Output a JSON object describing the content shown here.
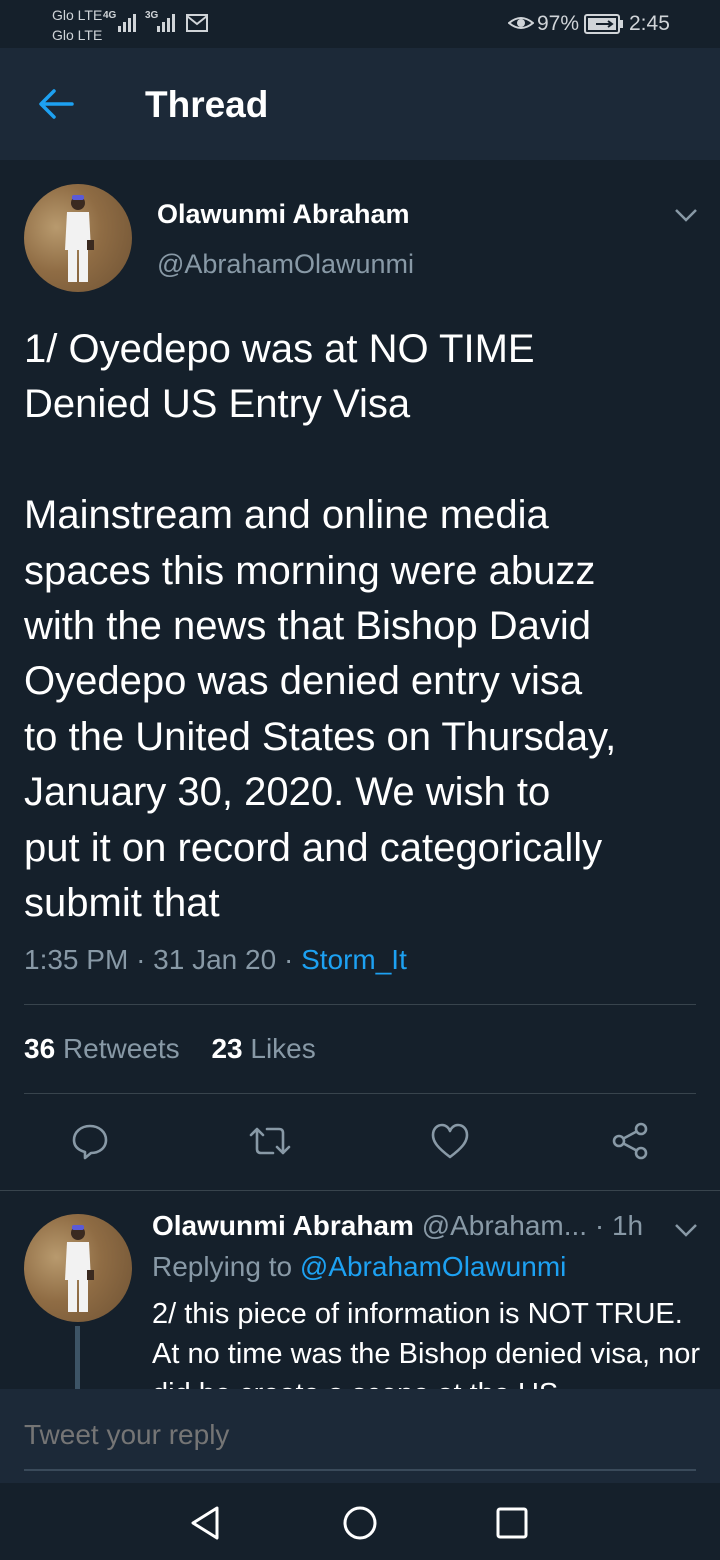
{
  "status_bar": {
    "carrier1": "Glo LTE",
    "carrier2": "Glo LTE",
    "net1": "4G",
    "net2": "3G",
    "battery": "97%",
    "time": "2:45",
    "icons": [
      "signal-icon",
      "mail-icon",
      "eye-icon",
      "battery-icon"
    ]
  },
  "header": {
    "title": "Thread",
    "back_icon": "back-arrow-icon"
  },
  "tweet": {
    "author_name": "Olawunmi Abraham",
    "author_handle": "@AbrahamOlawunmi",
    "text": "1/ Oyedepo was at NO TIME\nDenied US Entry Visa\n\nMainstream and online media\nspaces this morning were abuzz\nwith the news that Bishop David\nOyedepo was denied entry visa\nto the United States on Thursday,\nJanuary 30, 2020. We wish to\nput it on record and categorically\nsubmit that",
    "time": "1:35 PM",
    "date": "31 Jan 20",
    "source": "Storm_It",
    "retweet_count": "36",
    "retweet_label": "Retweets",
    "like_count": "23",
    "like_label": "Likes"
  },
  "actions": [
    "reply-icon",
    "retweet-icon",
    "like-icon",
    "share-icon"
  ],
  "reply": {
    "author_name": "Olawunmi Abraham",
    "author_handle": "@Abraham...",
    "age": "1h",
    "replying_prefix": "Replying to",
    "replying_to": "@AbrahamOlawunmi",
    "text": "2/ this piece of information is NOT TRUE. At no time was the Bishop denied visa, nor did he create a scene at the US"
  },
  "composer": {
    "placeholder": "Tweet your reply"
  },
  "colors": {
    "background": "#15202b",
    "header": "#1c2938",
    "accent": "#1da1f2",
    "muted": "#8899a6"
  }
}
